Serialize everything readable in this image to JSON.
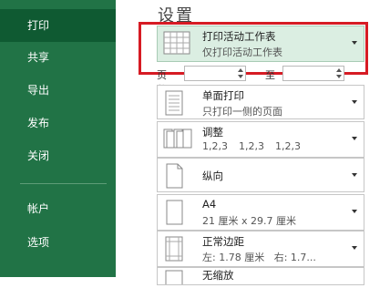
{
  "sidebar": {
    "items": [
      {
        "label": "打印",
        "active": true
      },
      {
        "label": "共享"
      },
      {
        "label": "导出"
      },
      {
        "label": "发布"
      },
      {
        "label": "关闭"
      },
      {
        "label": "帐户"
      },
      {
        "label": "选项"
      }
    ]
  },
  "settings": {
    "title": "设置",
    "print_what": {
      "title": "打印活动工作表",
      "subtitle": "仅打印活动工作表"
    },
    "pages": {
      "from_label": "页数:",
      "to_label": "至",
      "from_value": "",
      "to_value": ""
    },
    "sides": {
      "title": "单面打印",
      "subtitle": "只打印一侧的页面"
    },
    "collate": {
      "title": "调整",
      "subtitle_parts": [
        "1,2,3",
        "1,2,3",
        "1,2,3"
      ]
    },
    "orientation": {
      "title": "纵向"
    },
    "paper": {
      "title": "A4",
      "subtitle": "21 厘米 x 29.7 厘米"
    },
    "margins": {
      "title": "正常边距",
      "subtitle_left": "左: 1.78 厘米",
      "subtitle_right": "右: 1.7..."
    },
    "scaling": {
      "title": "无缩放"
    }
  },
  "colors": {
    "sidebar_bg": "#217346",
    "sidebar_active": "#0f5a32",
    "highlight": "#d61b24"
  }
}
